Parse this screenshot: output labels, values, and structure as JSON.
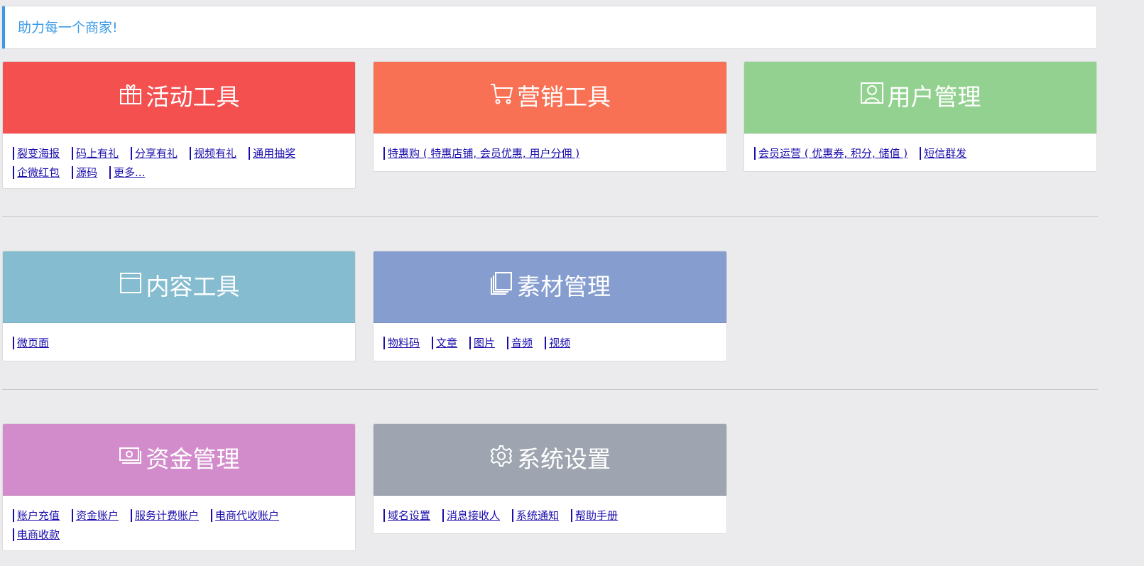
{
  "banner": {
    "text": "助力每一个商家!"
  },
  "cards": [
    {
      "title": "活动工具",
      "icon": "gift-icon",
      "color": "#f55050",
      "links": [
        "裂变海报",
        "码上有礼",
        "分享有礼",
        "视频有礼",
        "通用抽奖",
        "企微红包",
        "源码",
        "更多..."
      ]
    },
    {
      "title": "营销工具",
      "icon": "cart-icon",
      "color": "#f97155",
      "links": [
        "特惠购 ( 特惠店铺, 会员优惠, 用户分佣 )"
      ]
    },
    {
      "title": "用户管理",
      "icon": "user-icon",
      "color": "#92d18f",
      "links": [
        "会员运营 ( 优惠券, 积分, 储值 )",
        "短信群发"
      ]
    },
    {
      "title": "内容工具",
      "icon": "window-icon",
      "color": "#85bcd0",
      "links": [
        "微页面"
      ]
    },
    {
      "title": "素材管理",
      "icon": "copy-icon",
      "color": "#859dcf",
      "links": [
        "物料码",
        "文章",
        "图片",
        "音频",
        "视频"
      ]
    },
    {
      "title": "资金管理",
      "icon": "money-icon",
      "color": "#d38ccb",
      "links": [
        "账户充值",
        "资金账户",
        "服务计费账户",
        "电商代收账户",
        "电商收款"
      ]
    },
    {
      "title": "系统设置",
      "icon": "gear-icon",
      "color": "#9ea5b0",
      "links": [
        "域名设置",
        "消息接收人",
        "系统通知",
        "帮助手册"
      ]
    }
  ]
}
